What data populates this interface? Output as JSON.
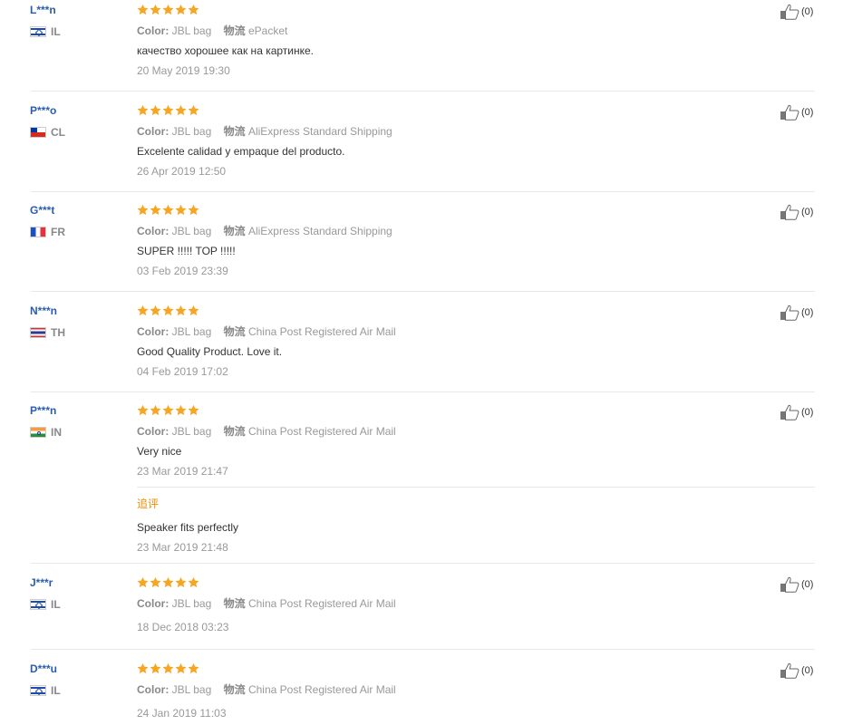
{
  "labels": {
    "color": "Color:",
    "shipping": "物流"
  },
  "reviews": [
    {
      "user": "L***n",
      "country": "IL",
      "rating": 5,
      "color": "JBL bag",
      "shipping": "ePacket",
      "text": "качество хорошее как на картинке.",
      "date": "20 May 2019 19:30",
      "helpful": "(0)"
    },
    {
      "user": "P***o",
      "country": "CL",
      "rating": 5,
      "color": "JBL bag",
      "shipping": "AliExpress Standard Shipping",
      "text": "Excelente calidad y empaque del producto.",
      "date": "26 Apr 2019 12:50",
      "helpful": "(0)"
    },
    {
      "user": "G***t",
      "country": "FR",
      "rating": 5,
      "color": "JBL bag",
      "shipping": "AliExpress Standard Shipping",
      "text": "SUPER !!!!! TOP !!!!!",
      "date": "03 Feb 2019 23:39",
      "helpful": "(0)"
    },
    {
      "user": "N***n",
      "country": "TH",
      "rating": 5,
      "color": "JBL bag",
      "shipping": "China Post Registered Air Mail",
      "text": "Good Quality Product. Love it.",
      "date": "04 Feb 2019 17:02",
      "helpful": "(0)"
    },
    {
      "user": "P***n",
      "country": "IN",
      "rating": 5,
      "color": "JBL bag",
      "shipping": "China Post Registered Air Mail",
      "text": "Very nice",
      "date": "23 Mar 2019 21:47",
      "helpful": "(0)",
      "followup": {
        "label": "追评",
        "text": "Speaker fits perfectly",
        "date": "23 Mar 2019 21:48"
      }
    },
    {
      "user": "J***r",
      "country": "IL",
      "rating": 5,
      "color": "JBL bag",
      "shipping": "China Post Registered Air Mail",
      "text": "",
      "date": "18 Dec 2018 03:23",
      "helpful": "(0)"
    },
    {
      "user": "D***u",
      "country": "IL",
      "rating": 5,
      "color": "JBL bag",
      "shipping": "China Post Registered Air Mail",
      "text": "",
      "date": "24 Jan 2019 11:03",
      "helpful": "(0)"
    }
  ],
  "colors": {
    "username": "#2a5dad",
    "star": "#f5a623",
    "followup": "#f08c00",
    "muted": "#999999"
  },
  "icons": {
    "rating": "star-icon",
    "helpful": "thumbs-up-icon"
  }
}
